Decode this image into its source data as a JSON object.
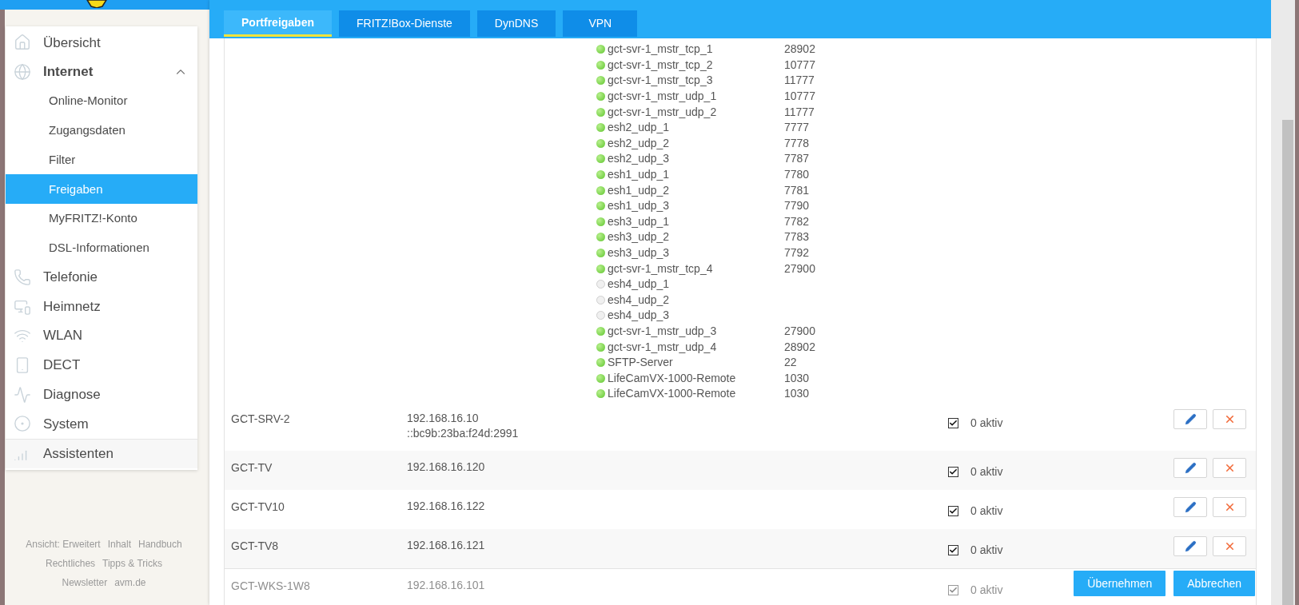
{
  "sidebar": {
    "items": [
      {
        "label": "Übersicht"
      },
      {
        "label": "Internet",
        "expanded": true,
        "children": [
          {
            "label": "Online-Monitor",
            "selected": false
          },
          {
            "label": "Zugangsdaten",
            "selected": false
          },
          {
            "label": "Filter",
            "selected": false
          },
          {
            "label": "Freigaben",
            "selected": true
          },
          {
            "label": "MyFRITZ!-Konto",
            "selected": false
          },
          {
            "label": "DSL-Informationen",
            "selected": false
          }
        ]
      },
      {
        "label": "Telefonie"
      },
      {
        "label": "Heimnetz"
      },
      {
        "label": "WLAN"
      },
      {
        "label": "DECT"
      },
      {
        "label": "Diagnose"
      },
      {
        "label": "System"
      },
      {
        "label": "Assistenten"
      }
    ]
  },
  "footer_links": [
    [
      "Ansicht: Erweitert",
      "Inhalt",
      "Handbuch"
    ],
    [
      "Rechtliches",
      "Tipps & Tricks"
    ],
    [
      "Newsletter",
      "avm.de"
    ]
  ],
  "tabs": [
    {
      "label": "Portfreigaben",
      "selected": true
    },
    {
      "label": "FRITZ!Box-Dienste",
      "selected": false
    },
    {
      "label": "DynDNS",
      "selected": false
    },
    {
      "label": "VPN",
      "selected": false
    }
  ],
  "table": {
    "rows": [
      {
        "ports": [
          {
            "name": "gct-svr-1_mstr_tcp_1",
            "port": "28902",
            "active": true
          },
          {
            "name": "gct-svr-1_mstr_tcp_2",
            "port": "10777",
            "active": true
          },
          {
            "name": "gct-svr-1_mstr_tcp_3",
            "port": "11777",
            "active": true
          },
          {
            "name": "gct-svr-1_mstr_udp_1",
            "port": "10777",
            "active": true
          },
          {
            "name": "gct-svr-1_mstr_udp_2",
            "port": "11777",
            "active": true
          },
          {
            "name": "esh2_udp_1",
            "port": "7777",
            "active": true
          },
          {
            "name": "esh2_udp_2",
            "port": "7778",
            "active": true
          },
          {
            "name": "esh2_udp_3",
            "port": "7787",
            "active": true
          },
          {
            "name": "esh1_udp_1",
            "port": "7780",
            "active": true
          },
          {
            "name": "esh1_udp_2",
            "port": "7781",
            "active": true
          },
          {
            "name": "esh1_udp_3",
            "port": "7790",
            "active": true
          },
          {
            "name": "esh3_udp_1",
            "port": "7782",
            "active": true
          },
          {
            "name": "esh3_udp_2",
            "port": "7783",
            "active": true
          },
          {
            "name": "esh3_udp_3",
            "port": "7792",
            "active": true
          },
          {
            "name": "gct-svr-1_mstr_tcp_4",
            "port": "27900",
            "active": true
          },
          {
            "name": "esh4_udp_1",
            "active": false
          },
          {
            "name": "esh4_udp_2",
            "active": false
          },
          {
            "name": "esh4_udp_3",
            "active": false
          },
          {
            "name": "gct-svr-1_mstr_udp_3",
            "port": "27900",
            "active": true
          },
          {
            "name": "gct-svr-1_mstr_udp_4",
            "port": "28902",
            "active": true
          },
          {
            "name": "SFTP-Server",
            "port": "22",
            "active": true
          },
          {
            "name": "LifeCamVX-1000-Remote",
            "port": "1030",
            "active": true
          },
          {
            "name": "LifeCamVX-1000-Remote",
            "port": "1030",
            "active": true
          }
        ]
      },
      {
        "name": "GCT-SRV-2",
        "addresses": [
          "192.168.16.10",
          "::bc9b:23ba:f24d:2991"
        ],
        "checked": true,
        "status": "0 aktiv"
      },
      {
        "name": "GCT-TV",
        "addresses": [
          "192.168.16.120"
        ],
        "checked": true,
        "status": "0 aktiv"
      },
      {
        "name": "GCT-TV10",
        "addresses": [
          "192.168.16.122"
        ],
        "checked": true,
        "status": "0 aktiv"
      },
      {
        "name": "GCT-TV8",
        "addresses": [
          "192.168.16.121"
        ],
        "checked": true,
        "status": "0 aktiv"
      },
      {
        "name": "GCT-WKS-1W8",
        "addresses": [
          "192.168.16.101"
        ],
        "checked": true,
        "status": "0 aktiv"
      }
    ]
  },
  "buttons": [
    "Übernehmen",
    "Abbrechen"
  ]
}
